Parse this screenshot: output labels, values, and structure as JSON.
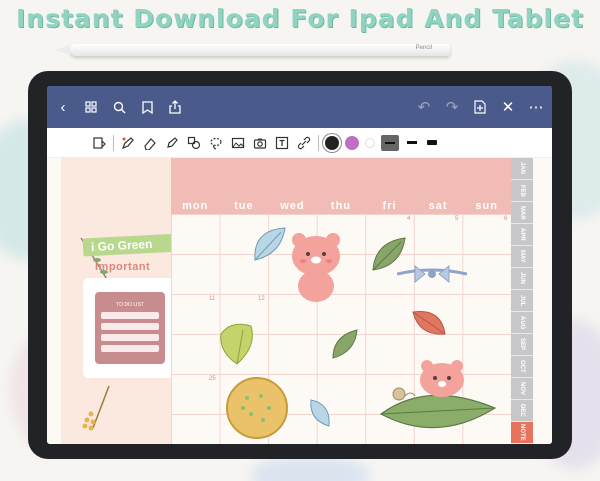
{
  "headline": "Instant Download For Ipad And Tablet",
  "pencil_label": "Pencil",
  "appbar": {
    "left_icons": [
      "back-icon",
      "grid-icon",
      "search-icon",
      "bookmark-icon",
      "share-icon"
    ],
    "right_icons": [
      "undo-icon",
      "redo-icon",
      "add-page-icon",
      "close-icon",
      "more-icon"
    ]
  },
  "toolbar": {
    "tools": [
      "read-mode-icon",
      "pen-icon",
      "eraser-icon",
      "highlighter-icon",
      "shapes-icon",
      "lasso-icon",
      "image-icon",
      "camera-icon",
      "text-icon",
      "link-icon"
    ],
    "colors": [
      "#222222",
      "#c06fc0",
      "#e6e6e6"
    ],
    "thickness_selected": "medium"
  },
  "planner": {
    "sticker_label": "i Go Green",
    "important_label": "Important",
    "todo_title": "TO DO LIST",
    "days": [
      "mon",
      "tue",
      "wed",
      "thu",
      "fri",
      "sat",
      "sun"
    ],
    "months": [
      "JAN",
      "FEB",
      "MAR",
      "APR",
      "MAY",
      "JUN",
      "JUL",
      "AUG",
      "SEP",
      "OCT",
      "NOV",
      "DEC",
      "NOTE"
    ]
  }
}
